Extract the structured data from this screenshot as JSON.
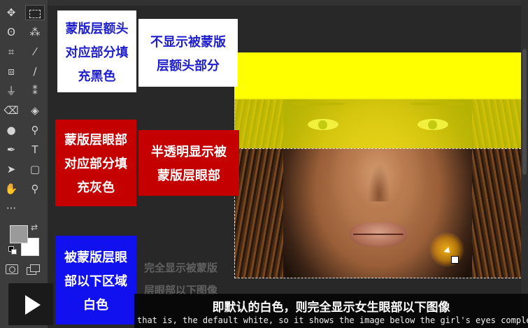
{
  "toolbar": {
    "tools": [
      {
        "name": "move-tool-icon",
        "glyph": "✥"
      },
      {
        "name": "rectangular-marquee-tool-icon",
        "glyph": ""
      },
      {
        "name": "lasso-tool-icon",
        "glyph": "ʘ"
      },
      {
        "name": "magic-wand-tool-icon",
        "glyph": "⁂"
      },
      {
        "name": "crop-tool-icon",
        "glyph": "⌗"
      },
      {
        "name": "eyedropper-tool-icon",
        "glyph": "⁄"
      },
      {
        "name": "spot-healing-tool-icon",
        "glyph": "⧈"
      },
      {
        "name": "brush-tool-icon",
        "glyph": "∕"
      },
      {
        "name": "clone-stamp-tool-icon",
        "glyph": "⏚"
      },
      {
        "name": "history-brush-tool-icon",
        "glyph": "⁑"
      },
      {
        "name": "eraser-tool-icon",
        "glyph": "⌫"
      },
      {
        "name": "paint-bucket-tool-icon",
        "glyph": "◈"
      },
      {
        "name": "blur-tool-icon",
        "glyph": "●"
      },
      {
        "name": "dodge-tool-icon",
        "glyph": "⚲"
      },
      {
        "name": "pen-tool-icon",
        "glyph": "✒"
      },
      {
        "name": "type-tool-icon",
        "glyph": "T"
      },
      {
        "name": "path-selection-tool-icon",
        "glyph": "➤"
      },
      {
        "name": "rectangle-tool-icon",
        "glyph": "▢"
      },
      {
        "name": "hand-tool-icon",
        "glyph": "✋"
      },
      {
        "name": "zoom-tool-icon",
        "glyph": "⚲"
      },
      {
        "name": "more-tools-icon",
        "glyph": "···"
      }
    ],
    "foreground_color": "#9a9a9a",
    "background_color": "#ffffff"
  },
  "callouts": {
    "mask_top": {
      "lines": [
        "蒙版层额头",
        "对应部分填",
        "充黑色"
      ]
    },
    "hide_top": {
      "lines": [
        "不显示被蒙版",
        "层额头部分"
      ]
    },
    "mask_eyes": {
      "lines": [
        "蒙版层眼部",
        "对应部分填",
        "充灰色"
      ]
    },
    "semi_eyes": {
      "lines": [
        "半透明显示被",
        "蒙版层眼部"
      ]
    },
    "masked_below": {
      "lines": [
        "被蒙版层眼",
        "部以下区域",
        "白色"
      ]
    }
  },
  "ghost_caption": {
    "line1": "完全显示被蒙版",
    "line2": "层眼部以下图像"
  },
  "subtitles": {
    "chinese": "即默认的白色，则完全显示女生眼部以下图像",
    "english": "that is, the default white, so it shows the image below the girl's eyes completely"
  },
  "colors": {
    "highlight_yellow": "#ffff00",
    "callout_red": "#c40000",
    "callout_blue": "#1111f0",
    "callout_white_text": "#1e1ecc"
  }
}
